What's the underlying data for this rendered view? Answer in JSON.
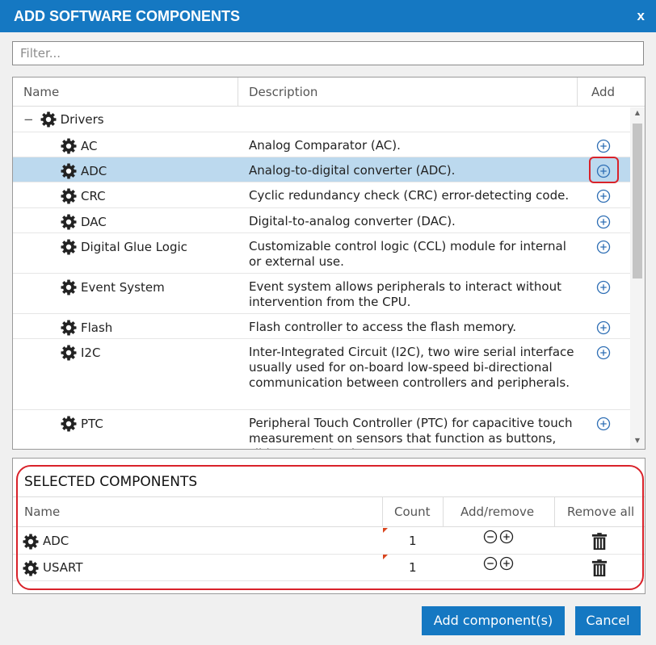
{
  "dialog": {
    "title": "ADD SOFTWARE COMPONENTS",
    "close_glyph": "x"
  },
  "filter": {
    "placeholder": "Filter...",
    "value": ""
  },
  "components_table": {
    "columns": {
      "name": "Name",
      "description": "Description",
      "add": "Add"
    },
    "group": {
      "toggle": "−",
      "label": "Drivers",
      "icon": "gear-icon"
    },
    "rows": [
      {
        "name": "AC",
        "description": "Analog Comparator (AC)."
      },
      {
        "name": "ADC",
        "description": "Analog-to-digital converter (ADC)."
      },
      {
        "name": "CRC",
        "description": "Cyclic redundancy check (CRC) error-detecting code."
      },
      {
        "name": "DAC",
        "description": "Digital-to-analog converter (DAC)."
      },
      {
        "name": "Digital Glue Logic",
        "description": "Customizable control logic (CCL) module for internal or external use."
      },
      {
        "name": "Event System",
        "description": "Event system allows peripherals to interact without intervention from the CPU."
      },
      {
        "name": "Flash",
        "description": "Flash controller to access the flash memory."
      },
      {
        "name": "I2C",
        "description": "Inter-Integrated Circuit (I2C), two wire serial interface usually used for on-board low-speed bi-directional communication between controllers and peripherals."
      },
      {
        "name": "PTC",
        "description": "Peripheral Touch Controller (PTC) for capacitive touch measurement on sensors that function as buttons, sliders and wheels."
      }
    ]
  },
  "selected": {
    "title": "SELECTED COMPONENTS",
    "columns": {
      "name": "Name",
      "count": "Count",
      "add_remove": "Add/remove",
      "remove_all": "Remove all"
    },
    "rows": [
      {
        "name": "ADC",
        "count": "1"
      },
      {
        "name": "USART",
        "count": "1"
      }
    ]
  },
  "buttons": {
    "add": "Add component(s)",
    "cancel": "Cancel"
  },
  "colors": {
    "accent": "#1578c2",
    "selection": "#bcd9ee",
    "highlight": "#d9222a"
  }
}
